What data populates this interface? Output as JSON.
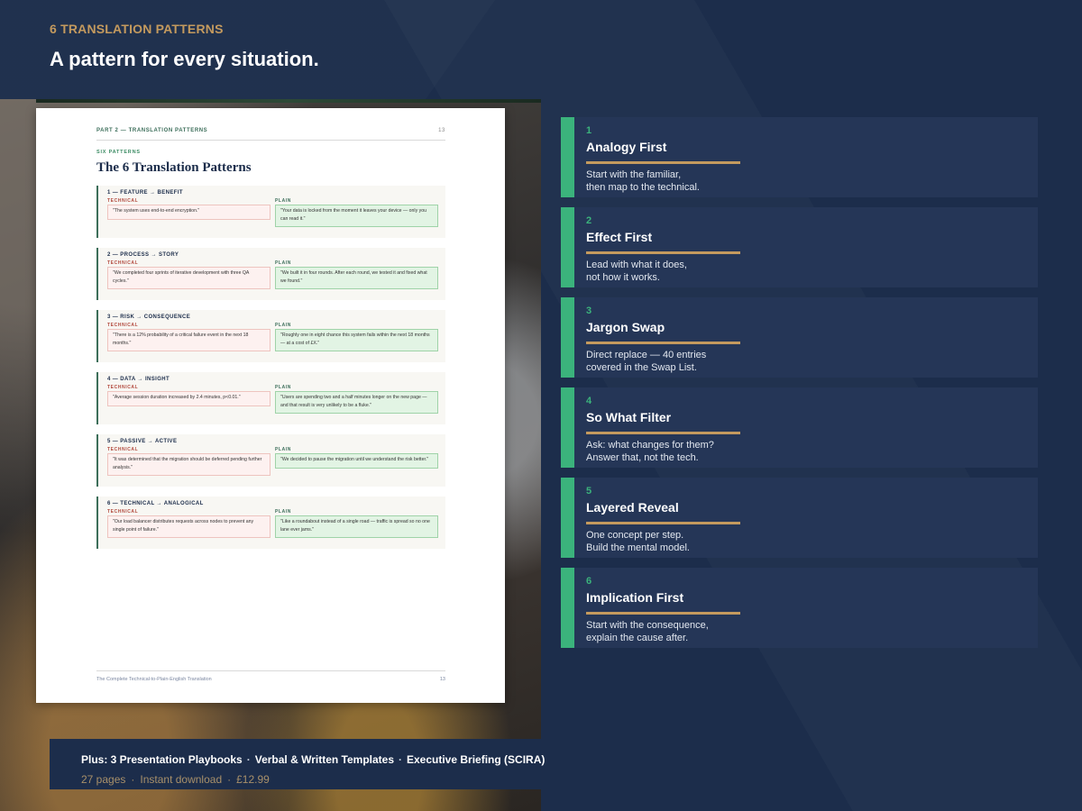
{
  "header": {
    "eyebrow": "6 TRANSLATION PATTERNS",
    "headline": "A pattern for every situation."
  },
  "colors": {
    "navy": "#1c2d4b",
    "card_bg": "#253657",
    "accent_green": "#3bb37c",
    "accent_gold": "#c49a5e"
  },
  "document": {
    "section_label": "PART 2 — TRANSLATION PATTERNS",
    "page_number": "13",
    "kicker": "SIX PATTERNS",
    "title": "The 6 Translation Patterns",
    "technical_label": "TECHNICAL",
    "plain_label": "PLAIN",
    "patterns": [
      {
        "title": "1 — FEATURE → BENEFIT",
        "technical": "\"The system uses end-to-end encryption.\"",
        "plain": "\"Your data is locked from the moment it leaves your device — only you can read it.\""
      },
      {
        "title": "2 — PROCESS → STORY",
        "technical": "\"We completed four sprints of iterative development with three QA cycles.\"",
        "plain": "\"We built it in four rounds. After each round, we tested it and fixed what we found.\""
      },
      {
        "title": "3 — RISK → CONSEQUENCE",
        "technical": "\"There is a 12% probability of a critical failure event in the next 18 months.\"",
        "plain": "\"Roughly one in eight chance this system fails within the next 18 months — at a cost of £X.\""
      },
      {
        "title": "4 — DATA → INSIGHT",
        "technical": "\"Average session duration increased by 2.4 minutes, p<0.01.\"",
        "plain": "\"Users are spending two and a half minutes longer on the new page — and that result is very unlikely to be a fluke.\""
      },
      {
        "title": "5 — PASSIVE → ACTIVE",
        "technical": "\"It was determined that the migration should be deferred pending further analysis.\"",
        "plain": "\"We decided to pause the migration until we understand the risk better.\""
      },
      {
        "title": "6 — TECHNICAL → ANALOGICAL",
        "technical": "\"Our load balancer distributes requests across nodes to prevent any single point of failure.\"",
        "plain": "\"Like a roundabout instead of a single road — traffic is spread so no one lane ever jams.\""
      }
    ],
    "footer_title": "The Complete Technical-to-Plain-English Translation",
    "footer_page": "13"
  },
  "cards": [
    {
      "number": "1",
      "title": "Analogy First",
      "description": "Start with the familiar,\nthen map to the technical."
    },
    {
      "number": "2",
      "title": "Effect First",
      "description": "Lead with what it does,\nnot how it works."
    },
    {
      "number": "3",
      "title": "Jargon Swap",
      "description": "Direct replace — 40 entries\ncovered in the Swap List."
    },
    {
      "number": "4",
      "title": "So What Filter",
      "description": "Ask: what changes for them?\nAnswer that, not the tech."
    },
    {
      "number": "5",
      "title": "Layered Reveal",
      "description": "One concept per step.\nBuild the mental model."
    },
    {
      "number": "6",
      "title": "Implication First",
      "description": "Start with the consequence,\nexplain the cause after."
    }
  ],
  "bottom": {
    "extras": [
      "Plus: 3 Presentation Playbooks",
      "Verbal & Written Templates",
      "Executive Briefing (SCIRA)"
    ],
    "meta": [
      "27 pages",
      "Instant download",
      "£12.99"
    ],
    "separator": "·"
  }
}
